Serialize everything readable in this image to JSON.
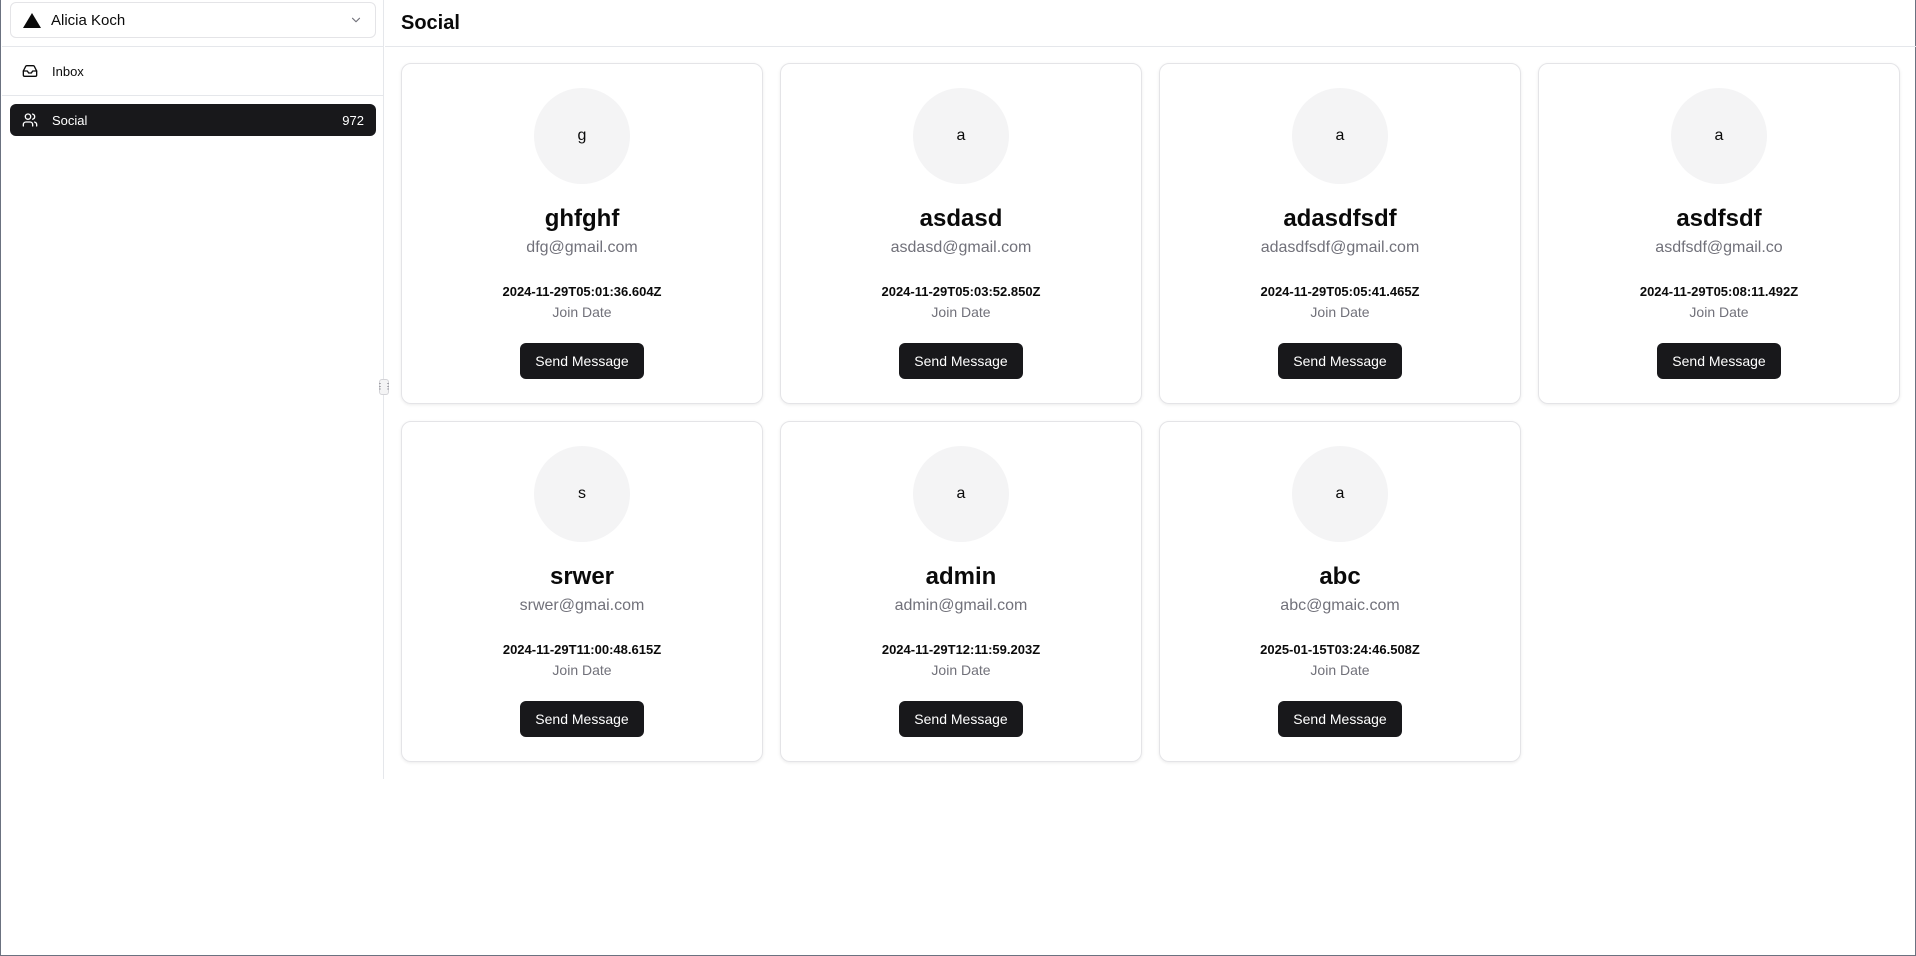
{
  "account": {
    "name": "Alicia Koch"
  },
  "nav": [
    {
      "label": "Inbox",
      "icon": "inbox-icon",
      "count": ""
    },
    {
      "label": "Social",
      "icon": "users-icon",
      "count": "972"
    }
  ],
  "page": {
    "title": "Social"
  },
  "users": [
    {
      "initial": "g",
      "name": "ghfghf",
      "email": "dfg@gmail.com",
      "join_date": "2024-11-29T05:01:36.604Z",
      "join_label": "Join Date",
      "button": "Send Message"
    },
    {
      "initial": "a",
      "name": "asdasd",
      "email": "asdasd@gmail.com",
      "join_date": "2024-11-29T05:03:52.850Z",
      "join_label": "Join Date",
      "button": "Send Message"
    },
    {
      "initial": "a",
      "name": "adasdfsdf",
      "email": "adasdfsdf@gmail.com",
      "join_date": "2024-11-29T05:05:41.465Z",
      "join_label": "Join Date",
      "button": "Send Message"
    },
    {
      "initial": "a",
      "name": "asdfsdf",
      "email": "asdfsdf@gmail.co",
      "join_date": "2024-11-29T05:08:11.492Z",
      "join_label": "Join Date",
      "button": "Send Message"
    },
    {
      "initial": "s",
      "name": "srwer",
      "email": "srwer@gmai.com",
      "join_date": "2024-11-29T11:00:48.615Z",
      "join_label": "Join Date",
      "button": "Send Message"
    },
    {
      "initial": "a",
      "name": "admin",
      "email": "admin@gmail.com",
      "join_date": "2024-11-29T12:11:59.203Z",
      "join_label": "Join Date",
      "button": "Send Message"
    },
    {
      "initial": "a",
      "name": "abc",
      "email": "abc@gmaic.com",
      "join_date": "2025-01-15T03:24:46.508Z",
      "join_label": "Join Date",
      "button": "Send Message"
    }
  ]
}
